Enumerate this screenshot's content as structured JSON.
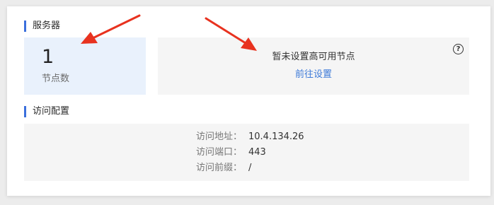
{
  "server_section": {
    "title": "服务器",
    "node_count": "1",
    "node_count_label": "节点数",
    "ha_message": "暂未设置高可用节点",
    "ha_link": "前往设置",
    "help_icon": "question-circle-icon"
  },
  "access_section": {
    "title": "访问配置",
    "rows": [
      {
        "label": "访问地址：",
        "value": "10.4.134.26"
      },
      {
        "label": "访问端口：",
        "value": "443"
      },
      {
        "label": "访问前缀：",
        "value": "/"
      }
    ]
  },
  "colors": {
    "accent": "#3b6fdc",
    "link": "#3d7ad8",
    "annotation_arrow": "#e8321f",
    "count_box_bg": "#e9f1fc",
    "panel_bg": "#f5f5f5"
  }
}
